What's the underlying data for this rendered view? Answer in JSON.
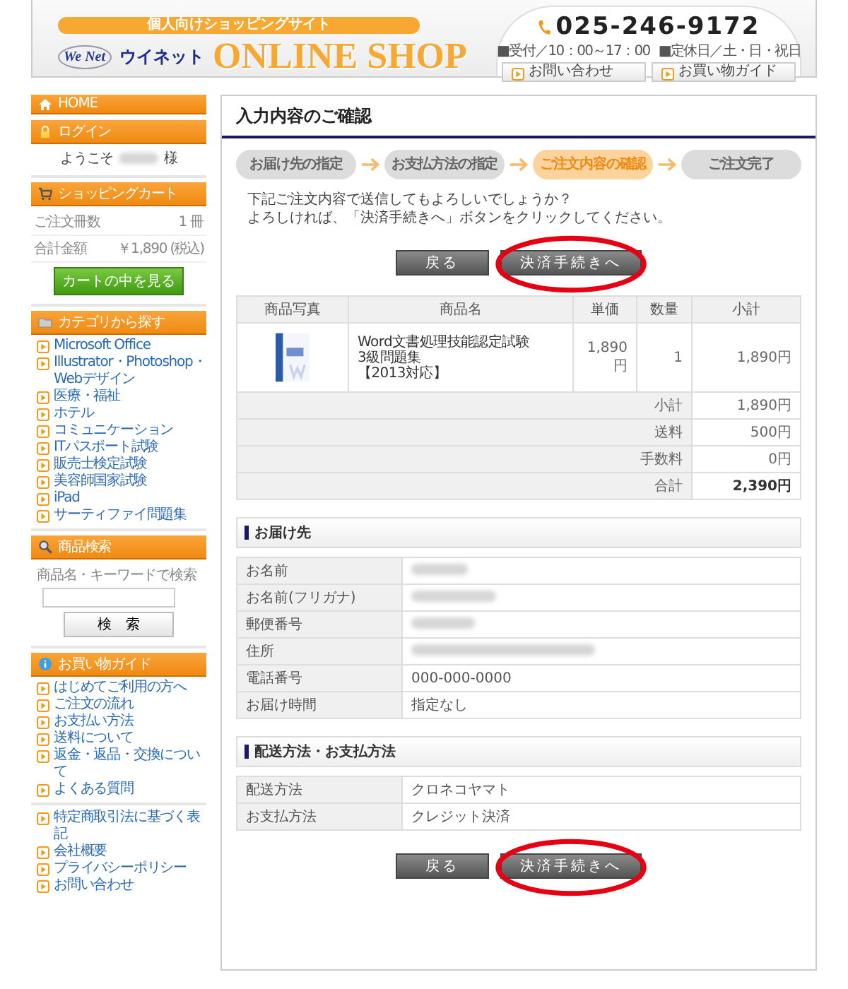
{
  "header": {
    "tagline": "個人向けショッピングサイト",
    "logo_mark": "We Net",
    "logo_text": "ウイネット",
    "shop_title": "ONLINE SHOP",
    "phone": "025-246-9172",
    "hours": [
      "■受付／10：00～17：00",
      "■定休日／土・日・祝日"
    ],
    "links": [
      "お問い合わせ",
      "お買い物ガイド"
    ]
  },
  "sidebar": {
    "home": "HOME",
    "login": {
      "title": "ログイン",
      "greeting": "ようこそ",
      "suffix": "様"
    },
    "cart": {
      "title": "ショッピングカート",
      "rows": [
        {
          "label": "ご注文冊数",
          "value": "1 冊",
          "note": ""
        },
        {
          "label": "合計金額",
          "value": "￥1,890",
          "note": "(税込)"
        }
      ],
      "button": "カートの中を見る"
    },
    "categories": {
      "title": "カテゴリから探す",
      "items": [
        "Microsoft Office",
        "Illustrator・Photoshop・Webデザイン",
        "医療・福祉",
        "ホテル",
        "コミュニケーション",
        "ITパスポート試験",
        "販売士検定試験",
        "美容師国家試験",
        "iPad",
        "サーティファイ問題集"
      ]
    },
    "search": {
      "title": "商品検索",
      "label": "商品名・キーワードで検索",
      "button": "検　索"
    },
    "guide": {
      "title": "お買い物ガイド",
      "items": [
        "はじめてご利用の方へ",
        "ご注文の流れ",
        "お支払い方法",
        "送料について",
        "返金・返品・交換について",
        "よくある質問"
      ]
    },
    "links": [
      "特定商取引法に基づく表記",
      "会社概要",
      "プライバシーポリシー",
      "お問い合わせ"
    ]
  },
  "main": {
    "title": "入力内容のご確認",
    "steps": [
      {
        "label": "お届け先の指定",
        "selected": false
      },
      {
        "label": "お支払方法の指定",
        "selected": false
      },
      {
        "label": "ご注文内容の確認",
        "selected": true
      },
      {
        "label": "ご注文完了",
        "selected": false
      }
    ],
    "message": [
      "下記ご注文内容で送信してもよろしいでしょうか？",
      "よろしければ、「決済手続きへ」ボタンをクリックしてください。"
    ],
    "buttons_top": [
      {
        "label": "戻る",
        "kind": "back",
        "circled": false
      },
      {
        "label": "決済手続きへ",
        "kind": "submit",
        "circled": true
      }
    ],
    "order_table": {
      "columns": [
        "商品写真",
        "商品名",
        "単価",
        "数量",
        "小計"
      ],
      "items": [
        {
          "name": [
            "Word文書処理技能認定試験",
            "3級問題集",
            "【2013対応】"
          ],
          "price": "1,890円",
          "quantity": "1",
          "subtotal": "1,890円"
        }
      ],
      "summary": [
        {
          "label": "小計",
          "value": "1,890円",
          "kind": "normal"
        },
        {
          "label": "送料",
          "value": "500円",
          "kind": "normal"
        },
        {
          "label": "手数料",
          "value": "0円",
          "kind": "normal"
        },
        {
          "label": "合計",
          "value": "2,390円",
          "kind": "total"
        }
      ]
    },
    "delivery": {
      "title": "お届け先",
      "rows": [
        {
          "label": "お名前",
          "kind": "redacted"
        },
        {
          "label": "お名前(フリガナ)",
          "kind": "redacted"
        },
        {
          "label": "郵便番号",
          "kind": "redacted"
        },
        {
          "label": "住所",
          "kind": "redacted"
        },
        {
          "label": "電話番号",
          "kind": "text",
          "value": "000-000-0000"
        },
        {
          "label": "お届け時間",
          "kind": "text",
          "value": "指定なし"
        }
      ]
    },
    "shipping": {
      "title": "配送方法・お支払方法",
      "rows": [
        {
          "label": "配送方法",
          "kind": "text",
          "value": "クロネコヤマト"
        },
        {
          "label": "お支払方法",
          "kind": "text",
          "value": "クレジット決済"
        }
      ]
    },
    "buttons_bottom": [
      {
        "label": "戻る",
        "kind": "back",
        "circled": false
      },
      {
        "label": "決済手続きへ",
        "kind": "submit",
        "circled": true
      }
    ]
  }
}
